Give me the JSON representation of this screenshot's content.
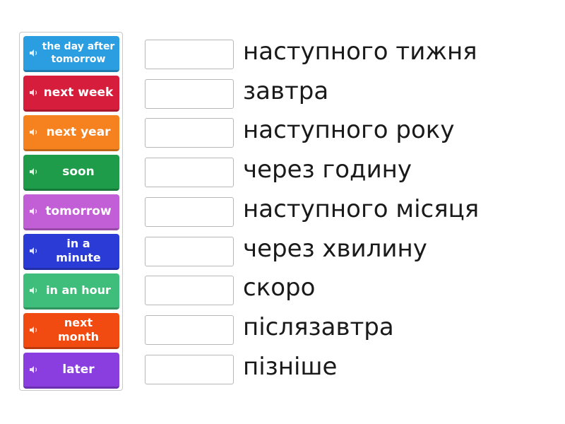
{
  "tiles": [
    {
      "label": "the day after\ntomorrow",
      "color": "#2a9ee0",
      "icon": "speaker-icon"
    },
    {
      "label": "next week",
      "color": "#d61e3c",
      "icon": "speaker-icon"
    },
    {
      "label": "next year",
      "color": "#f5821f",
      "icon": "speaker-icon"
    },
    {
      "label": "soon",
      "color": "#1e9c4a",
      "icon": "speaker-icon"
    },
    {
      "label": "tomorrow",
      "color": "#c25fd6",
      "icon": "speaker-icon"
    },
    {
      "label": "in a\nminute",
      "color": "#2b3bd6",
      "icon": "speaker-icon"
    },
    {
      "label": "in an hour",
      "color": "#3fbd7a",
      "icon": "speaker-icon"
    },
    {
      "label": "next\nmonth",
      "color": "#f24b12",
      "icon": "speaker-icon"
    },
    {
      "label": "later",
      "color": "#8a3ee0",
      "icon": "speaker-icon"
    }
  ],
  "targets": [
    "наступного тижня",
    "завтра",
    "наступного року",
    "через годину",
    "наступного місяця",
    "через хвилину",
    "скоро",
    "післязавтра",
    "пізніше"
  ]
}
